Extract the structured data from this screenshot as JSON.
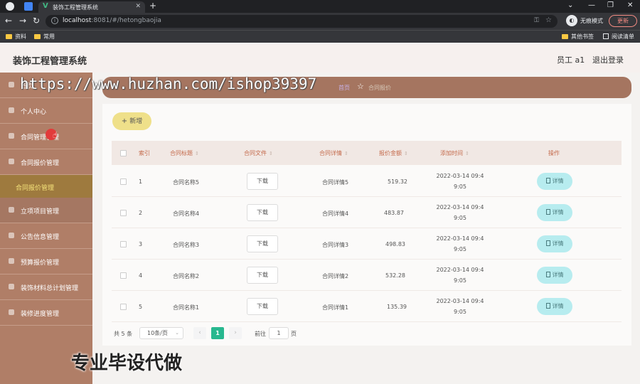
{
  "browser": {
    "tab_title": "装饰工程管理系统",
    "url_host": "localhost",
    "url_rest": ":8081/#/hetongbaojia",
    "incognito_label": "无痕模式",
    "update_label": "更新",
    "bookmarks": [
      "资料",
      "常用"
    ],
    "other_bookmarks": "其他书签",
    "reading_list": "阅读清单"
  },
  "header": {
    "title": "装饰工程管理系统",
    "user": "员工 a1",
    "logout": "退出登录"
  },
  "sidebar": {
    "items": [
      {
        "label": "首页",
        "icon": "home-icon"
      },
      {
        "label": "个人中心",
        "icon": "user-icon"
      },
      {
        "label": "合同管理管理",
        "icon": "list-icon"
      },
      {
        "label": "合同报价管理",
        "icon": "doc-icon"
      },
      {
        "label": "合同报价管理",
        "icon": "",
        "active": true
      },
      {
        "label": "立项项目管理",
        "icon": "project-icon"
      },
      {
        "label": "公告信息管理",
        "icon": "notice-icon"
      },
      {
        "label": "预算报价管理",
        "icon": "budget-icon"
      },
      {
        "label": "装饰材料总计划管理",
        "icon": "material-icon"
      },
      {
        "label": "装修进度管理",
        "icon": "progress-icon"
      }
    ]
  },
  "breadcrumb": {
    "home": "首页",
    "current": "合同报价"
  },
  "watermark": {
    "url": "https://www.huzhan.com/ishop39397",
    "slogan": "专业毕设代做"
  },
  "toolbar": {
    "add_label": "新增"
  },
  "table": {
    "headers": {
      "index": "索引",
      "title": "合同标题",
      "file": "合同文件",
      "detail": "合同详情",
      "amount": "报价金额",
      "time": "添加时间",
      "action": "操作"
    },
    "download_label": "下载",
    "detail_label": "详情",
    "rows": [
      {
        "index": "1",
        "title": "合同名称5",
        "detail": "合同详情5",
        "amount": "519.32",
        "time1": "2022-03-14 09:4",
        "time2": "9:05"
      },
      {
        "index": "2",
        "title": "合同名称4",
        "detail": "合同详情4",
        "amount": "483.87",
        "time1": "2022-03-14 09:4",
        "time2": "9:05"
      },
      {
        "index": "3",
        "title": "合同名称3",
        "detail": "合同详情3",
        "amount": "498.83",
        "time1": "2022-03-14 09:4",
        "time2": "9:05"
      },
      {
        "index": "4",
        "title": "合同名称2",
        "detail": "合同详情2",
        "amount": "532.28",
        "time1": "2022-03-14 09:4",
        "time2": "9:05"
      },
      {
        "index": "5",
        "title": "合同名称1",
        "detail": "合同详情1",
        "amount": "135.39",
        "time1": "2022-03-14 09:4",
        "time2": "9:05"
      }
    ]
  },
  "pagination": {
    "total": "共 5 条",
    "page_size": "10条/页",
    "current_page": "1",
    "goto_label": "前往",
    "goto_value": "1",
    "page_suffix": "页"
  }
}
